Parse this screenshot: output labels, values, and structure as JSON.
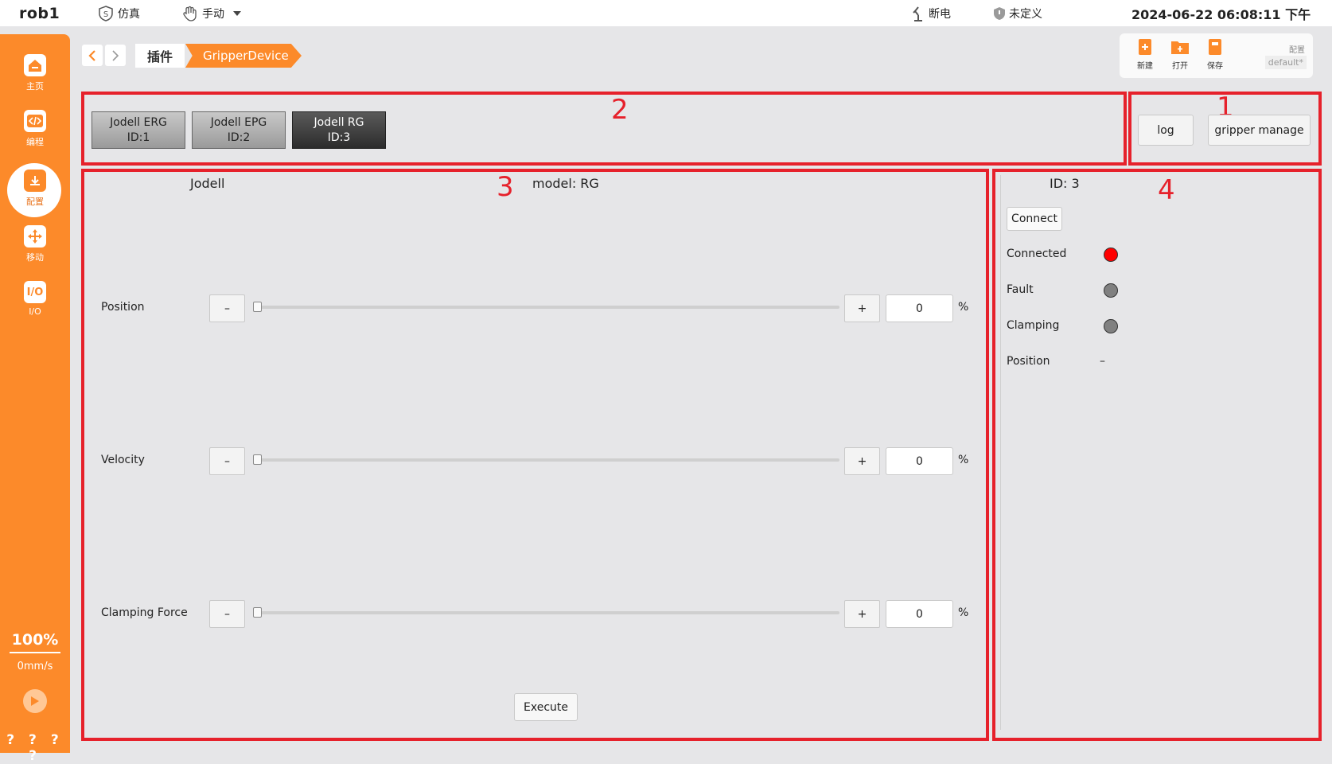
{
  "topbar": {
    "app_title": "rob1",
    "mode_sim": "仿真",
    "mode_manual": "手动",
    "power": "断电",
    "safety": "未定义",
    "datetime": "2024-06-22 06:08:11 下午"
  },
  "sidebar": {
    "items": [
      {
        "label": "主页",
        "icon": "home-icon"
      },
      {
        "label": "编程",
        "icon": "code-icon"
      },
      {
        "label": "配置",
        "icon": "config-icon"
      },
      {
        "label": "移动",
        "icon": "move-icon"
      },
      {
        "label": "I/O",
        "icon": "io-icon"
      }
    ],
    "speed_percent": "100%",
    "speed_mms": "0mm/s",
    "status_marks": "? ? ? ?"
  },
  "breadcrumb": {
    "plugin": "插件",
    "device": "GripperDevice"
  },
  "file_toolbar": {
    "new_label": "新建",
    "open_label": "打开",
    "save_label": "保存",
    "config_title": "配置",
    "config_value": "default*"
  },
  "annotations": [
    "1",
    "2",
    "3",
    "4"
  ],
  "devices": [
    {
      "name": "Jodell ERG",
      "id": "ID:1",
      "selected": false
    },
    {
      "name": "Jodell EPG",
      "id": "ID:2",
      "selected": false
    },
    {
      "name": "Jodell RG",
      "id": "ID:3",
      "selected": true
    }
  ],
  "actions": {
    "log": "log",
    "gripper_manage": "gripper manage"
  },
  "control": {
    "brand": "Jodell",
    "model": "model: RG",
    "rows": [
      {
        "label": "Position",
        "minus": "–",
        "plus": "+",
        "value": "0",
        "unit": "%",
        "level": 0
      },
      {
        "label": "Velocity",
        "minus": "–",
        "plus": "+",
        "value": "0",
        "unit": "%",
        "level": 0
      },
      {
        "label": "Clamping Force",
        "minus": "–",
        "plus": "+",
        "value": "0",
        "unit": "%",
        "level": 0
      }
    ],
    "execute": "Execute"
  },
  "status": {
    "id": "ID: 3",
    "connect": "Connect",
    "items": [
      {
        "label": "Connected",
        "color": "#ff0000"
      },
      {
        "label": "Fault",
        "color": "#808080"
      },
      {
        "label": "Clamping",
        "color": "#808080"
      }
    ],
    "position_label": "Position",
    "position_value": "–"
  },
  "colors": {
    "accent": "#fc8a2a",
    "annotation": "#e6212b"
  }
}
